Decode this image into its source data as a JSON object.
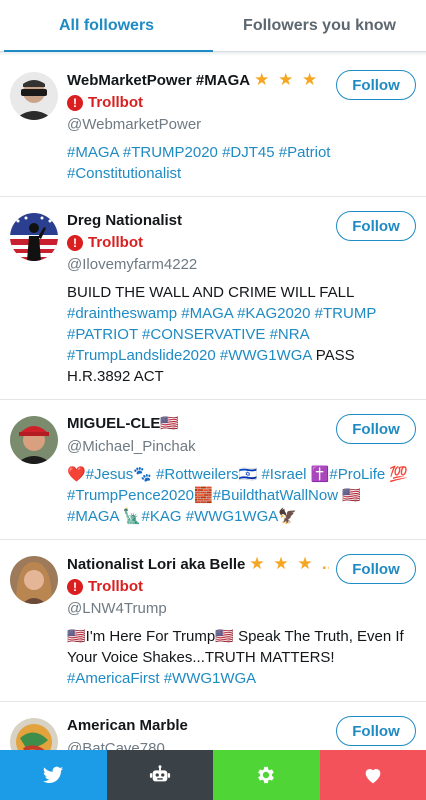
{
  "tabs": [
    {
      "label": "All followers",
      "active": true
    },
    {
      "label": "Followers you know",
      "active": false
    }
  ],
  "follow_label": "Follow",
  "trollbot_label": "Trollbot",
  "trollbot_icon": "!",
  "accent_color": "#1f8bc3",
  "trollbot_color": "#d91f1f",
  "followers": [
    {
      "name": "WebMarketPower #MAGA",
      "stars": "★ ★ ★",
      "trollbot": true,
      "handle": "@WebmarketPower",
      "bio": [
        {
          "t": "#MAGA",
          "tag": true
        },
        {
          "t": " "
        },
        {
          "t": "#TRUMP2020",
          "tag": true
        },
        {
          "t": " "
        },
        {
          "t": "#DJT45",
          "tag": true
        },
        {
          "t": " "
        },
        {
          "t": "#Patriot",
          "tag": true
        },
        {
          "t": " "
        },
        {
          "t": "#Constitutionalist",
          "tag": true
        }
      ]
    },
    {
      "name": "Dreg Nationalist",
      "stars": "",
      "trollbot": true,
      "handle": "@Ilovemyfarm4222",
      "bio": [
        {
          "t": "BUILD THE WALL AND CRIME WILL FALL "
        },
        {
          "t": "#draintheswamp",
          "tag": true
        },
        {
          "t": " "
        },
        {
          "t": "#MAGA",
          "tag": true
        },
        {
          "t": " "
        },
        {
          "t": "#KAG2020",
          "tag": true
        },
        {
          "t": " "
        },
        {
          "t": "#TRUMP",
          "tag": true
        },
        {
          "t": " "
        },
        {
          "t": "#PATRIOT",
          "tag": true
        },
        {
          "t": " "
        },
        {
          "t": "#CONSERVATIVE",
          "tag": true
        },
        {
          "t": " "
        },
        {
          "t": "#NRA",
          "tag": true
        },
        {
          "t": " "
        },
        {
          "t": "#TrumpLandslide2020",
          "tag": true
        },
        {
          "t": " "
        },
        {
          "t": "#WWG1WGA",
          "tag": true
        },
        {
          "t": " PASS H.R.3892 ACT"
        }
      ]
    },
    {
      "name": "MIGUEL-CLE🇺🇸",
      "stars": "",
      "trollbot": false,
      "handle": "@Michael_Pinchak",
      "bio": [
        {
          "t": "❤️"
        },
        {
          "t": "#Jesus",
          "tag": true
        },
        {
          "t": "🐾 "
        },
        {
          "t": "#Rottweilers",
          "tag": true
        },
        {
          "t": "🇮🇱 "
        },
        {
          "t": "#Israel",
          "tag": true
        },
        {
          "t": " ✝️"
        },
        {
          "t": "#ProLife",
          "tag": true
        },
        {
          "t": " 💯 "
        },
        {
          "t": "#TrumpPence2020",
          "tag": true
        },
        {
          "t": "🧱"
        },
        {
          "t": "#BuildthatWallNow",
          "tag": true
        },
        {
          "t": " 🇺🇸 "
        },
        {
          "t": "#MAGA",
          "tag": true
        },
        {
          "t": " 🗽"
        },
        {
          "t": "#KAG",
          "tag": true
        },
        {
          "t": " "
        },
        {
          "t": "#WWG1WGA",
          "tag": true
        },
        {
          "t": "🦅"
        }
      ]
    },
    {
      "name": "Nationalist Lori aka Belle",
      "stars": "★ ★ ★ …",
      "trollbot": true,
      "handle": "@LNW4Trump",
      "bio": [
        {
          "t": "🇺🇸I'm Here For Trump🇺🇸 Speak The Truth, Even If Your Voice Shakes...TRUTH MATTERS! "
        },
        {
          "t": "#AmericaFirst",
          "tag": true
        },
        {
          "t": " "
        },
        {
          "t": "#WWG1WGA",
          "tag": true
        }
      ]
    },
    {
      "name": "American Marble",
      "stars": "",
      "trollbot": false,
      "handle": "@BatCave780",
      "bio": []
    }
  ],
  "bottom_bar": [
    {
      "icon": "twitter-bird-icon",
      "color": "#1c9be7"
    },
    {
      "icon": "robot-icon",
      "color": "#3a4147"
    },
    {
      "icon": "gear-icon",
      "color": "#4fd636"
    },
    {
      "icon": "heart-icon",
      "color": "#f4525b"
    }
  ]
}
